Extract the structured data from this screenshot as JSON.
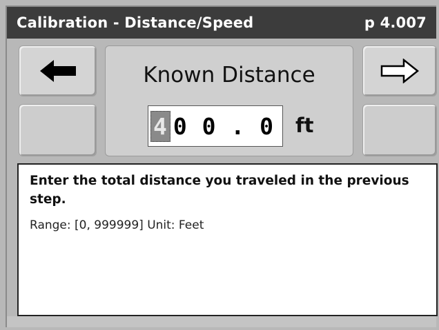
{
  "titlebar": {
    "title": "Calibration - Distance/Speed",
    "page": "p 4.007"
  },
  "nav": {
    "back_icon": "arrow-left-filled-icon",
    "next_icon": "arrow-right-outline-icon"
  },
  "panel": {
    "title": "Known Distance",
    "value_first_digit": "4",
    "value_rest": "0 0 . 0",
    "unit": "ft"
  },
  "help": {
    "text": "Enter the total distance you traveled in the previous step.",
    "range": "Range: [0, 999999]  Unit: Feet"
  },
  "colors": {
    "titlebar": "#3c3c3c",
    "background": "#b8b8b8",
    "button": "#d4d4d4"
  }
}
